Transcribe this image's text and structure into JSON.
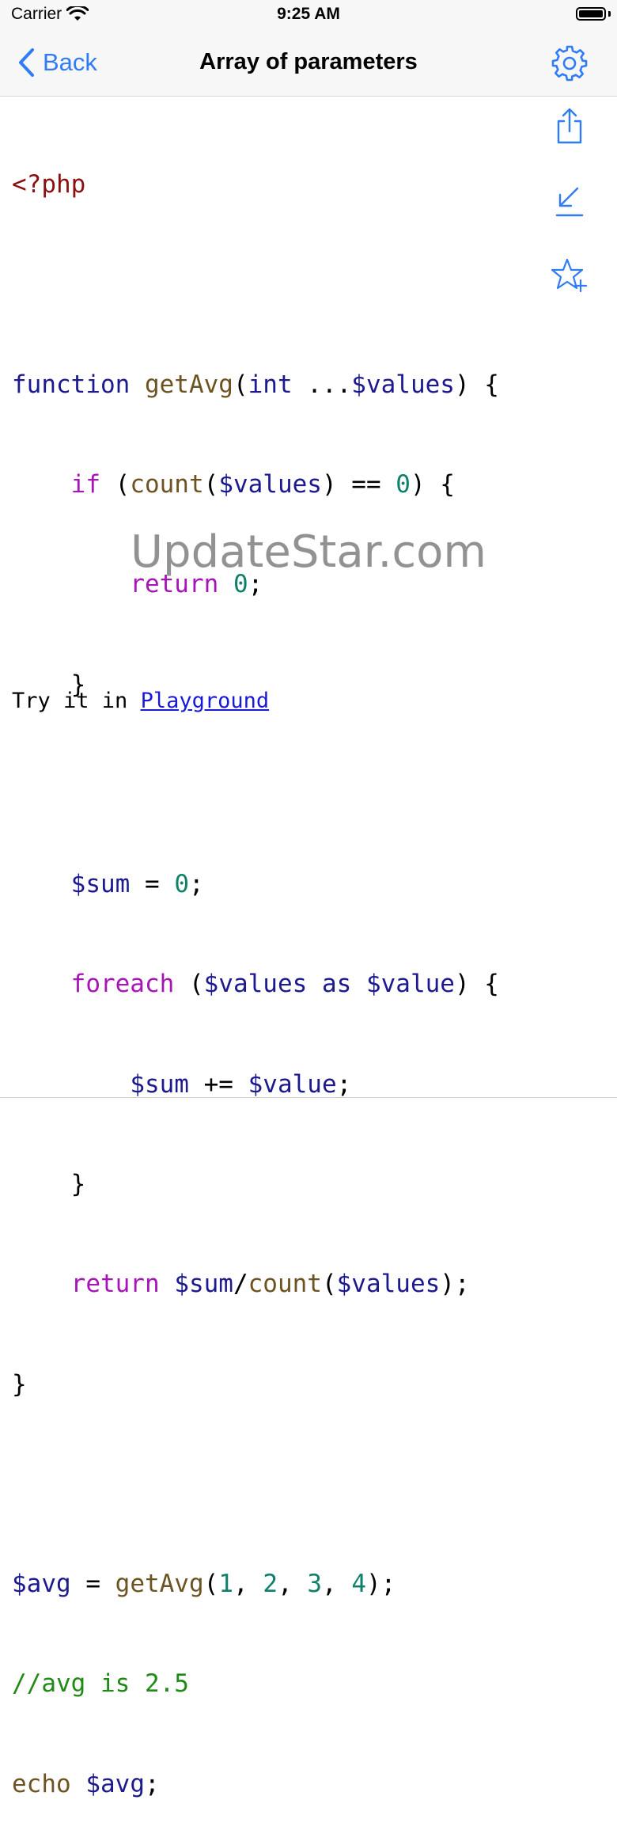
{
  "status": {
    "carrier": "Carrier",
    "time": "9:25 AM"
  },
  "nav": {
    "back_label": "Back",
    "title": "Array of parameters"
  },
  "code": {
    "l1": [
      "<?php"
    ],
    "l3": [
      "function",
      " ",
      "getAvg",
      "(",
      "int",
      " ...",
      "$values",
      ") {"
    ],
    "l4": [
      "    ",
      "if",
      " (",
      "count",
      "(",
      "$values",
      ") == ",
      "0",
      ") {"
    ],
    "l5": [
      "        ",
      "return",
      " ",
      "0",
      ";"
    ],
    "l6": [
      "    }"
    ],
    "l8": [
      "    ",
      "$sum",
      " = ",
      "0",
      ";"
    ],
    "l9": [
      "    ",
      "foreach",
      " (",
      "$values",
      " ",
      "as",
      " ",
      "$value",
      ") {"
    ],
    "l10": [
      "        ",
      "$sum",
      " += ",
      "$value",
      ";"
    ],
    "l11": [
      "    }"
    ],
    "l12": [
      "    ",
      "return",
      " ",
      "$sum",
      "/",
      "count",
      "(",
      "$values",
      ");"
    ],
    "l13": [
      "}"
    ],
    "l15": [
      "$avg",
      " = ",
      "getAvg",
      "(",
      "1",
      ", ",
      "2",
      ", ",
      "3",
      ", ",
      "4",
      ");"
    ],
    "l16": [
      "//avg is 2.5"
    ],
    "l17": [
      "echo",
      " ",
      "$avg",
      ";"
    ]
  },
  "footer": {
    "try_text": "Try it in ",
    "link_label": "Playground"
  },
  "watermark": "UpdateStar.com",
  "icons": {
    "back": "chevron-left-icon",
    "settings": "gear-icon",
    "share": "share-icon",
    "import": "arrow-down-left-icon",
    "favorite": "star-plus-icon"
  },
  "colors": {
    "accent": "#2f7cf6",
    "php_tag": "#8a0f0f",
    "keyword": "#1d1a8f",
    "function": "#6d5321",
    "control": "#a615b6",
    "number": "#10806a",
    "comment": "#1f8a16",
    "link": "#1a1ad6"
  }
}
